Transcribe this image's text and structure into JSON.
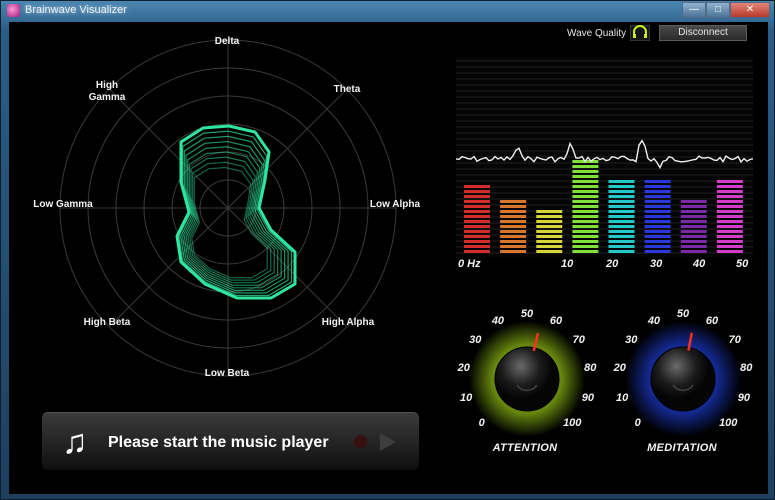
{
  "window": {
    "title": "Brainwave Visualizer",
    "minimize": "—",
    "maximize": "□",
    "close": "✕"
  },
  "radar": {
    "labels": {
      "delta": "Delta",
      "theta": "Theta",
      "low_alpha": "Low Alpha",
      "high_alpha": "High Alpha",
      "low_beta": "Low Beta",
      "high_beta": "High Beta",
      "low_gamma": "Low Gamma",
      "high_gamma": "High Gamma"
    },
    "shape_color": "#2ee6a0"
  },
  "music": {
    "icon": "music-note-icon",
    "message": "Please start the music player"
  },
  "header": {
    "wave_quality_label": "Wave Quality",
    "wave_quality_icon": "headset-icon",
    "wave_quality_color": "#c8f01e",
    "disconnect_label": "Disconnect"
  },
  "chart_data": {
    "type": "bar",
    "x_ticks": [
      "0 Hz",
      "10",
      "20",
      "30",
      "40",
      "50"
    ],
    "bands": [
      {
        "color": "#d42b2b",
        "level": 0.72
      },
      {
        "color": "#d8772b",
        "level": 0.55
      },
      {
        "color": "#d7d43a",
        "level": 0.48
      },
      {
        "color": "#7fe03a",
        "level": 0.97
      },
      {
        "color": "#23c9c9",
        "level": 0.78
      },
      {
        "color": "#2a38d9",
        "level": 0.75
      },
      {
        "color": "#7a2aa6",
        "level": 0.55
      },
      {
        "color": "#d23cc8",
        "level": 0.78
      }
    ],
    "grid": true
  },
  "attention": {
    "title": "ATTENTION",
    "value": 55,
    "ticks": [
      "0",
      "10",
      "20",
      "30",
      "40",
      "50",
      "60",
      "70",
      "80",
      "90",
      "100"
    ],
    "glow_color": "#b6f01a"
  },
  "meditation": {
    "title": "MEDITATION",
    "value": 54,
    "ticks": [
      "0",
      "10",
      "20",
      "30",
      "40",
      "50",
      "60",
      "70",
      "80",
      "90",
      "100"
    ],
    "glow_color": "#2448ff"
  }
}
